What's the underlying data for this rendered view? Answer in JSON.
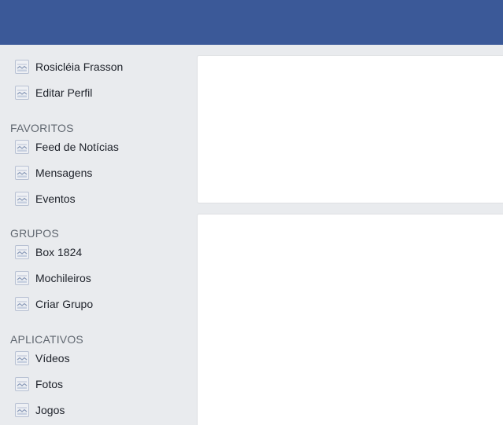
{
  "colors": {
    "topbar": "#3b5998",
    "background": "#e9ebee",
    "card": "#ffffff",
    "section_title": "#606770",
    "nav_text": "#1d2129"
  },
  "profile": {
    "items": [
      {
        "label": "Rosicléia Frasson",
        "icon": "image-placeholder-icon"
      },
      {
        "label": "Editar Perfil",
        "icon": "image-placeholder-icon"
      }
    ]
  },
  "favorites": {
    "title": "FAVORITOS",
    "items": [
      {
        "label": "Feed de Notícias",
        "icon": "image-placeholder-icon"
      },
      {
        "label": "Mensagens",
        "icon": "image-placeholder-icon"
      },
      {
        "label": "Eventos",
        "icon": "image-placeholder-icon"
      }
    ]
  },
  "groups": {
    "title": "GRUPOS",
    "items": [
      {
        "label": "Box 1824",
        "icon": "image-placeholder-icon"
      },
      {
        "label": "Mochileiros",
        "icon": "image-placeholder-icon"
      },
      {
        "label": "Criar Grupo",
        "icon": "image-placeholder-icon"
      }
    ]
  },
  "apps": {
    "title": "APLICATIVOS",
    "items": [
      {
        "label": "Vídeos",
        "icon": "image-placeholder-icon"
      },
      {
        "label": "Fotos",
        "icon": "image-placeholder-icon"
      },
      {
        "label": "Jogos",
        "icon": "image-placeholder-icon"
      }
    ]
  }
}
